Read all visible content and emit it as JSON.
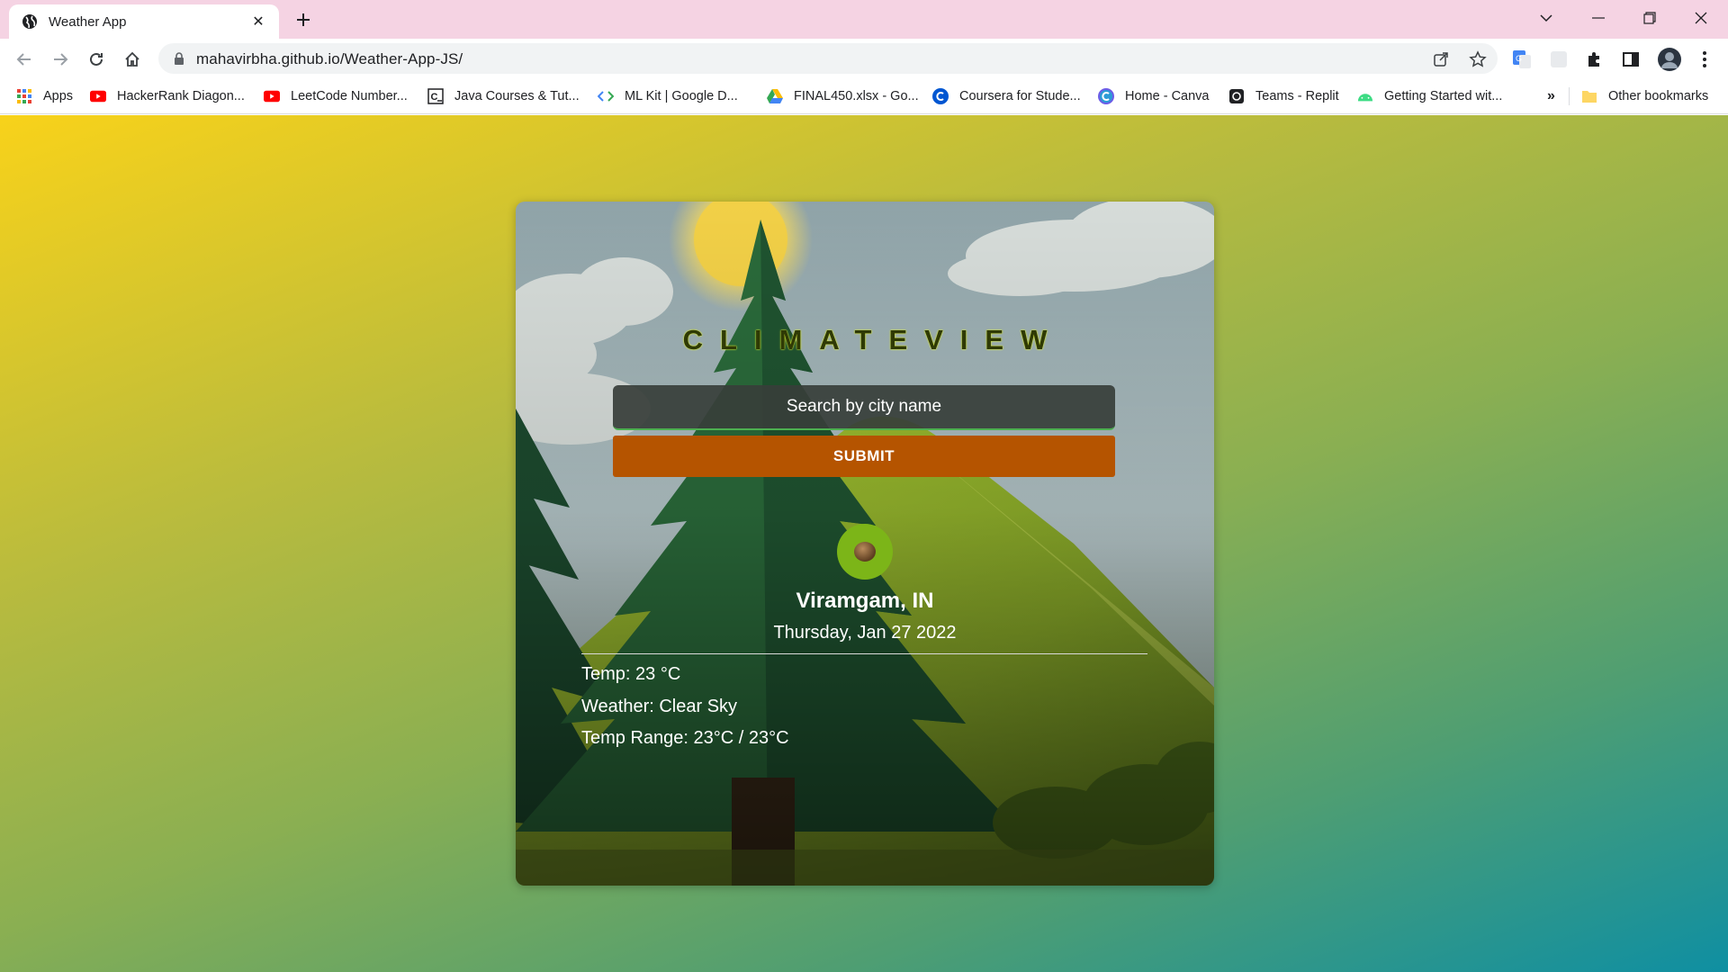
{
  "browser": {
    "tab_title": "Weather App",
    "url": "mahavirbha.github.io/Weather-App-JS/"
  },
  "bookmarks": [
    {
      "label": "Apps",
      "icon": "apps-grid-icon"
    },
    {
      "label": "HackerRank Diagon...",
      "icon": "youtube-icon"
    },
    {
      "label": "LeetCode Number...",
      "icon": "youtube-icon"
    },
    {
      "label": "Java Courses & Tut...",
      "icon": "codecademy-icon"
    },
    {
      "label": "ML Kit  |  Google D...",
      "icon": "code-brackets-icon"
    },
    {
      "label": "FINAL450.xlsx - Go...",
      "icon": "google-drive-icon"
    },
    {
      "label": "Coursera for Stude...",
      "icon": "coursera-icon"
    },
    {
      "label": "Home - Canva",
      "icon": "canva-icon"
    },
    {
      "label": "Teams - Replit",
      "icon": "replit-icon"
    },
    {
      "label": "Getting Started wit...",
      "icon": "android-icon"
    }
  ],
  "bookmarks_overflow": "»",
  "other_bookmarks": "Other bookmarks",
  "app": {
    "brand": "CLIMATEVIEW",
    "search_placeholder": "Search by city name",
    "submit_label": "SUBMIT",
    "weather_icon": "clear-sky-icon",
    "city": "Viramgam, IN",
    "date": "Thursday, Jan 27 2022",
    "temp": "Temp: 23 °C",
    "weather": "Weather: Clear Sky",
    "temp_range": "Temp Range: 23°C / 23°C"
  },
  "colors": {
    "tabstrip": "#f5d3e3",
    "submit": "#b55400",
    "gradient_start": "#f8d21a",
    "gradient_end": "#0f8fa2"
  }
}
